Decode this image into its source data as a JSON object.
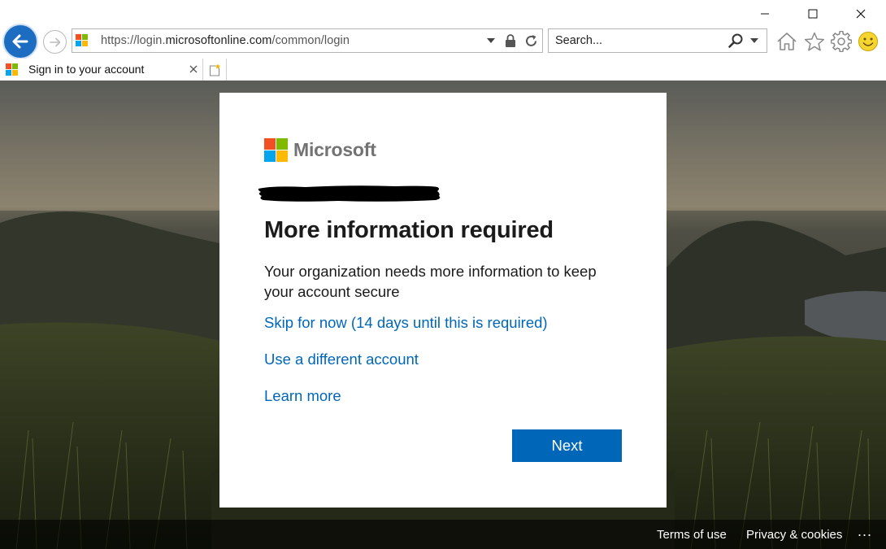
{
  "browser": {
    "url_prefix": "https://login.",
    "url_domain": "microsoftonline.com",
    "url_path": "/common/login",
    "search_placeholder": "Search...",
    "tab_title": "Sign in to your account",
    "window_controls": [
      "minimize-icon",
      "maximize-icon",
      "close-icon"
    ],
    "toolbar_icons": [
      "home-icon",
      "star-icon",
      "gear-icon",
      "smiley-icon"
    ]
  },
  "card": {
    "brand": "Microsoft",
    "heading": "More information required",
    "description": "Your organization needs more information to keep your account secure",
    "links": {
      "skip": "Skip for now (14 days until this is required)",
      "different_account": "Use a different account",
      "learn_more": "Learn more"
    },
    "next_label": "Next"
  },
  "footer": {
    "terms": "Terms of use",
    "privacy": "Privacy & cookies",
    "more": "..."
  },
  "colors": {
    "accent": "#0067b8",
    "ms_red": "#f25022",
    "ms_green": "#7fba00",
    "ms_blue": "#00a4ef",
    "ms_yellow": "#ffb900",
    "back_button": "#1c6dc2"
  }
}
